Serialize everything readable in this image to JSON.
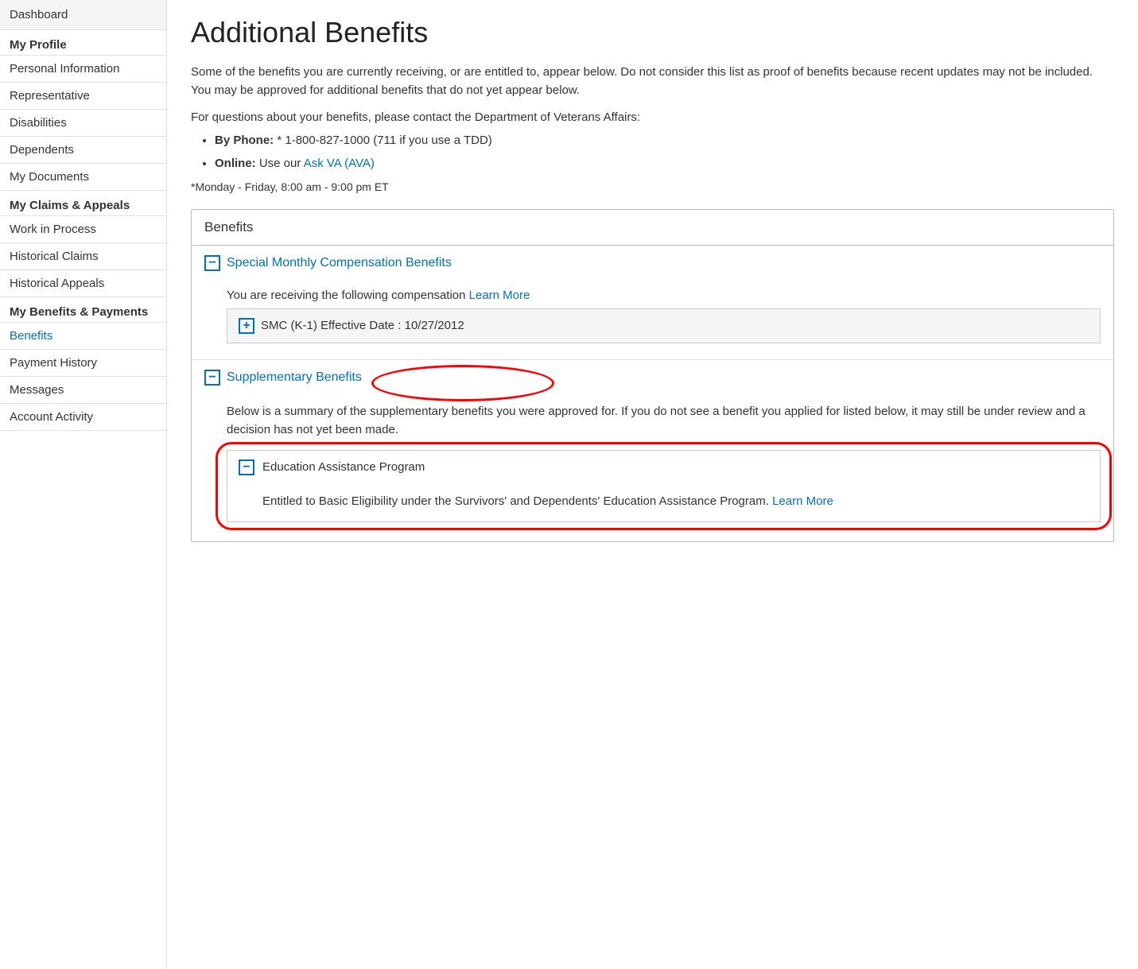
{
  "sidebar": {
    "dashboard_label": "Dashboard",
    "sections": [
      {
        "header": "My Profile",
        "items": [
          {
            "label": "Personal Information",
            "active": false
          },
          {
            "label": "Representative",
            "active": false
          },
          {
            "label": "Disabilities",
            "active": false
          },
          {
            "label": "Dependents",
            "active": false
          },
          {
            "label": "My Documents",
            "active": false
          }
        ]
      },
      {
        "header": "My Claims & Appeals",
        "items": [
          {
            "label": "Work in Process",
            "active": false
          },
          {
            "label": "Historical Claims",
            "active": false
          },
          {
            "label": "Historical Appeals",
            "active": false
          }
        ]
      },
      {
        "header": "My Benefits & Payments",
        "items": [
          {
            "label": "Benefits",
            "active": true
          },
          {
            "label": "Payment History",
            "active": false
          }
        ]
      },
      {
        "header": null,
        "items": [
          {
            "label": "Messages",
            "active": false
          },
          {
            "label": "Account Activity",
            "active": false
          }
        ]
      }
    ]
  },
  "main": {
    "page_title": "Additional Benefits",
    "intro_paragraph": "Some of the benefits you are currently receiving, or are entitled to, appear below. Do not consider this list as proof of benefits because recent updates may not be included. You may be approved for additional benefits that do not yet appear below.",
    "contact_intro": "For questions about your benefits, please contact the Department of Veterans Affairs:",
    "contact_phone_label": "By Phone:",
    "contact_phone_note": "* 1-800-827-1000 (711 if you use a TDD)",
    "contact_online_label": "Online:",
    "contact_online_text": "Use our ",
    "contact_online_link": "Ask VA (AVA)",
    "hours_note": "*Monday - Friday, 8:00 am - 9:00 pm ET",
    "benefits_panel_title": "Benefits",
    "benefit_sections": [
      {
        "id": "special-monthly",
        "toggle": "minus",
        "title": "Special Monthly Compensation Benefits",
        "body_text": "You are receiving the following compensation",
        "learn_more_link": "Learn More",
        "sub_items": [
          {
            "toggle": "plus",
            "label": "SMC (K-1) Effective Date : 10/27/2012"
          }
        ]
      },
      {
        "id": "supplementary",
        "toggle": "minus",
        "title": "Supplementary Benefits",
        "body_text": "Below is a summary of the supplementary benefits you were approved for. If you do not see a benefit you applied for listed below, it may still be under review and a decision has not yet been made.",
        "sub_items": [
          {
            "toggle": "minus",
            "label": "Education Assistance Program",
            "body": "Entitled to Basic Eligibility under the Survivors' and Dependents' Education Assistance Program.",
            "learn_more_link": "Learn More"
          }
        ]
      }
    ]
  }
}
